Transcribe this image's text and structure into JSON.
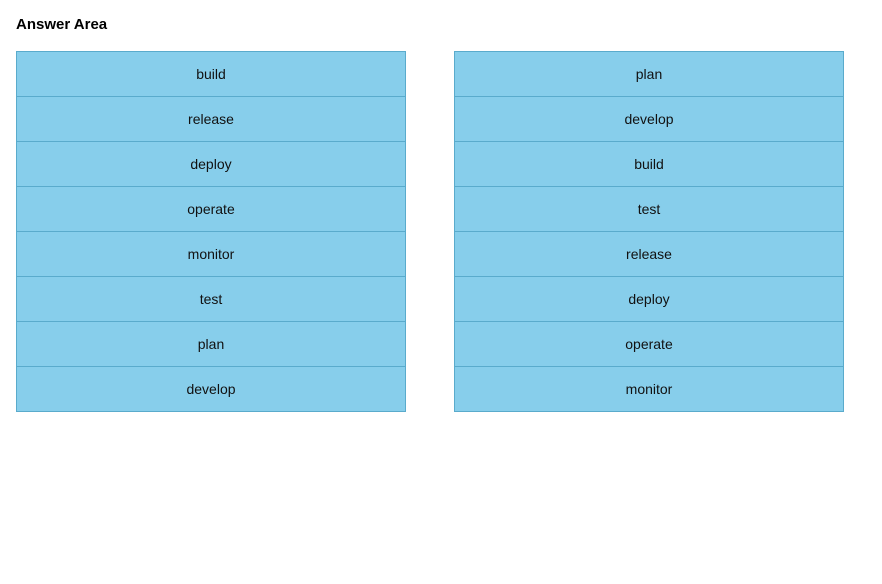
{
  "header": {
    "title": "Answer Area"
  },
  "left_column": {
    "items": [
      {
        "label": "build"
      },
      {
        "label": "release"
      },
      {
        "label": "deploy"
      },
      {
        "label": "operate"
      },
      {
        "label": "monitor"
      },
      {
        "label": "test"
      },
      {
        "label": "plan"
      },
      {
        "label": "develop"
      }
    ]
  },
  "right_column": {
    "items": [
      {
        "label": "plan"
      },
      {
        "label": "develop"
      },
      {
        "label": "build"
      },
      {
        "label": "test"
      },
      {
        "label": "release"
      },
      {
        "label": "deploy"
      },
      {
        "label": "operate"
      },
      {
        "label": "monitor"
      }
    ]
  }
}
